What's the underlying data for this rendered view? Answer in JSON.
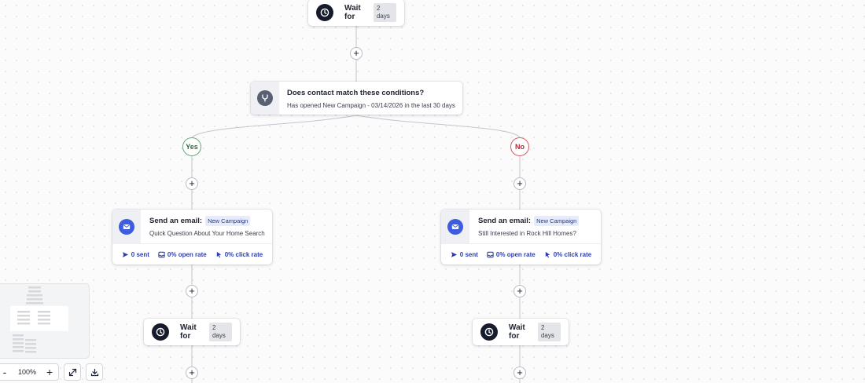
{
  "flow": {
    "top_wait": {
      "label": "Wait for",
      "duration": "2 days"
    },
    "condition": {
      "title": "Does contact match these conditions?",
      "subtitle": "Has opened New Campaign - 03/14/2026 in the last 30 days"
    },
    "plus_symbol": "+",
    "branches": [
      {
        "label": "Yes",
        "email": {
          "title": "Send an email:",
          "tag": "New Campaign",
          "subject": "Quick Question About Your Home Search",
          "stats": {
            "sent": "0 sent",
            "open_rate": "0% open rate",
            "click_rate": "0% click rate"
          }
        },
        "wait": {
          "label": "Wait for",
          "duration": "2 days"
        }
      },
      {
        "label": "No",
        "email": {
          "title": "Send an email:",
          "tag": "New Campaign",
          "subject": "Still Interested in Rock Hill Homes?",
          "stats": {
            "sent": "0 sent",
            "open_rate": "0% open rate",
            "click_rate": "0% click rate"
          }
        },
        "wait": {
          "label": "Wait for",
          "duration": "2 days"
        }
      }
    ]
  },
  "zoom_controls": {
    "zoom_out": "-",
    "zoom_level": "100%",
    "zoom_in": "+"
  },
  "icons": {
    "wait": "clock-icon",
    "condition": "branch-icon",
    "email": "mail-icon",
    "sent": "send-icon",
    "open": "inbox-icon",
    "click": "cursor-icon",
    "fit": "expand-icon",
    "export": "download-icon"
  },
  "colors": {
    "accent": "#3d5ce0",
    "stat_text": "#2c3db5",
    "yes_border": "#6aa77a",
    "no_border": "#d55b6a",
    "dark_icon": "#171b2e"
  }
}
